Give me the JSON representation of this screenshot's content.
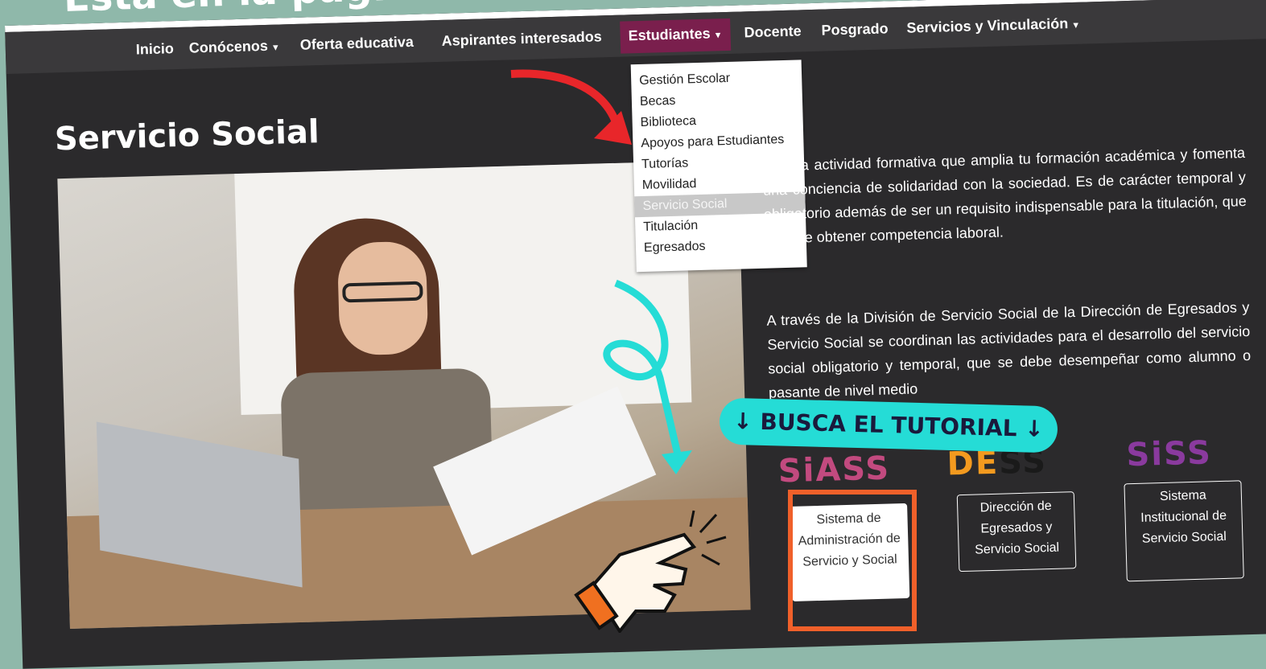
{
  "caption": "Está en la pág. del CU",
  "nav": {
    "items": [
      "Inicio",
      "Conócenos",
      "Oferta educativa",
      "Aspirantes interesados",
      "Estudiantes",
      "Docente",
      "Posgrado",
      "Servicios y Vinculación"
    ],
    "active": "Estudiantes"
  },
  "page_title": "Servicio Social",
  "dropdown": {
    "items": [
      "Gestión Escolar",
      "Becas",
      "Biblioteca",
      "Apoyos para Estudiantes",
      "Tutorías",
      "Movilidad",
      "Servicio Social",
      "Titulación",
      "Egresados"
    ],
    "highlighted": "Servicio Social"
  },
  "paragraphs": [
    "Es una actividad formativa que amplia tu formación académica y fomenta una conciencia de solidaridad con la sociedad. Es de carácter temporal y obligatorio además de ser un requisito indispensable para la titulación, que permite obtener competencia laboral.",
    "A través de la División de Servicio Social de la Dirección de Egresados y Servicio Social se coordinan las actividades para el desarrollo del servicio social obligatorio y temporal, que se debe desempeñar como alumno o pasante de nivel medio"
  ],
  "tutorial_label": "↓ BUSCA EL TUTORIAL ↓",
  "logos": {
    "siass": "SiASS",
    "dess_de": "DE",
    "dess_ss": "SS",
    "siss": "SiSS"
  },
  "systems": [
    {
      "label": "Sistema de Administración de Servicio y Social"
    },
    {
      "label": "Dirección de Egresados y Servicio Social"
    },
    {
      "label": "Sistema Institucional de Servicio Social"
    }
  ],
  "colors": {
    "accent_active": "#7a1f4d",
    "tutorial": "#25dcd6",
    "arrow_red": "#e8262a",
    "highlight_orange": "#f0602a"
  }
}
